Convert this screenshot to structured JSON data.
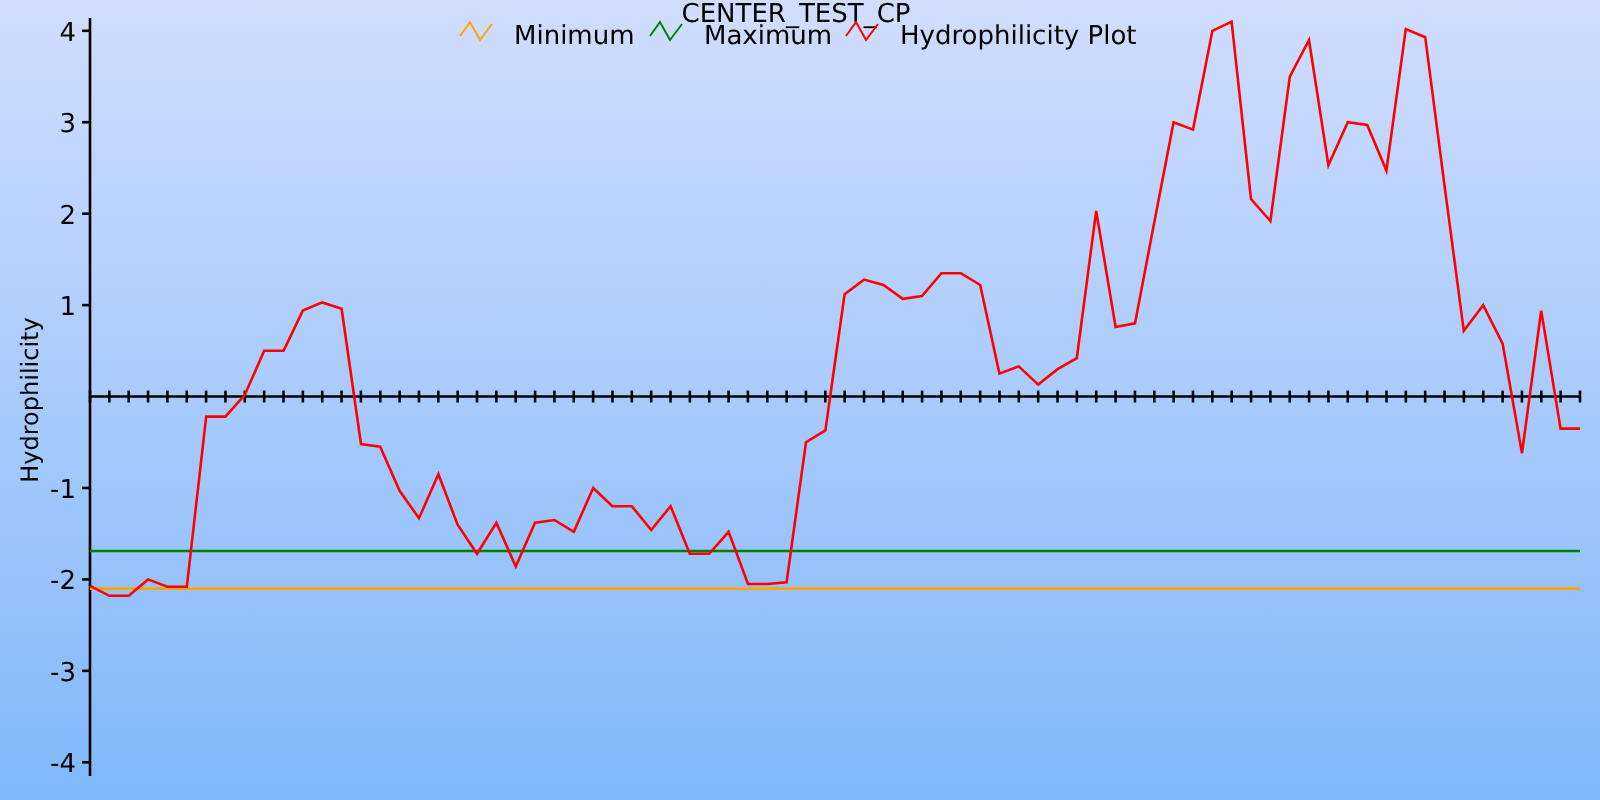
{
  "chart_data": {
    "type": "line",
    "title": "CENTER_TEST_CP",
    "ylabel": "Hydrophilicity",
    "ylim": [
      -4.15,
      4.14
    ],
    "legend": true,
    "yticks": [
      -4,
      -3,
      -2,
      -1,
      1,
      2,
      3,
      4
    ],
    "series": [
      {
        "name": "Minimum",
        "color": "#ffa500",
        "values": [
          -2.1,
          -2.1,
          -2.1,
          -2.1,
          -2.1,
          -2.1,
          -2.1,
          -2.1,
          -2.1,
          -2.1,
          -2.1,
          -2.1,
          -2.1,
          -2.1,
          -2.1,
          -2.1,
          -2.1,
          -2.1,
          -2.1,
          -2.1,
          -2.1,
          -2.1,
          -2.1,
          -2.1,
          -2.1,
          -2.1,
          -2.1,
          -2.1,
          -2.1,
          -2.1,
          -2.1,
          -2.1,
          -2.1,
          -2.1,
          -2.1,
          -2.1,
          -2.1,
          -2.1,
          -2.1,
          -2.1,
          -2.1,
          -2.1,
          -2.1,
          -2.1,
          -2.1,
          -2.1,
          -2.1,
          -2.1,
          -2.1,
          -2.1,
          -2.1,
          -2.1,
          -2.1,
          -2.1,
          -2.1,
          -2.1,
          -2.1,
          -2.1,
          -2.1,
          -2.1,
          -2.1,
          -2.1,
          -2.1,
          -2.1,
          -2.1,
          -2.1,
          -2.1,
          -2.1,
          -2.1,
          -2.1,
          -2.1,
          -2.1,
          -2.1,
          -2.1,
          -2.1,
          -2.1,
          -2.1,
          -2.1
        ]
      },
      {
        "name": "Maximum",
        "color": "#008000",
        "values": [
          -1.69,
          -1.69,
          -1.69,
          -1.69,
          -1.69,
          -1.69,
          -1.69,
          -1.69,
          -1.69,
          -1.69,
          -1.69,
          -1.69,
          -1.69,
          -1.69,
          -1.69,
          -1.69,
          -1.69,
          -1.69,
          -1.69,
          -1.69,
          -1.69,
          -1.69,
          -1.69,
          -1.69,
          -1.69,
          -1.69,
          -1.69,
          -1.69,
          -1.69,
          -1.69,
          -1.69,
          -1.69,
          -1.69,
          -1.69,
          -1.69,
          -1.69,
          -1.69,
          -1.69,
          -1.69,
          -1.69,
          -1.69,
          -1.69,
          -1.69,
          -1.69,
          -1.69,
          -1.69,
          -1.69,
          -1.69,
          -1.69,
          -1.69,
          -1.69,
          -1.69,
          -1.69,
          -1.69,
          -1.69,
          -1.69,
          -1.69,
          -1.69,
          -1.69,
          -1.69,
          -1.69,
          -1.69,
          -1.69,
          -1.69,
          -1.69,
          -1.69,
          -1.69,
          -1.69,
          -1.69,
          -1.69,
          -1.69,
          -1.69,
          -1.69,
          -1.69,
          -1.69,
          -1.69,
          -1.69,
          -1.69
        ]
      },
      {
        "name": "Hydrophilicity Plot",
        "color": "#ff0000",
        "values": [
          -2.07,
          -2.18,
          -2.18,
          -2.0,
          -2.08,
          -2.08,
          -0.22,
          -0.22,
          0.02,
          0.5,
          0.5,
          0.94,
          1.03,
          0.96,
          -0.52,
          -0.55,
          -1.03,
          -1.33,
          -0.85,
          -1.4,
          -1.72,
          -1.38,
          -1.86,
          -1.38,
          -1.35,
          -1.48,
          -1.0,
          -1.2,
          -1.2,
          -1.46,
          -1.2,
          -1.72,
          -1.72,
          -1.48,
          -2.05,
          -2.05,
          -2.03,
          -0.5,
          -0.37,
          1.12,
          1.28,
          1.22,
          1.07,
          1.1,
          1.35,
          1.35,
          1.22,
          0.25,
          0.33,
          0.13,
          0.3,
          0.42,
          2.03,
          0.76,
          0.8,
          1.9,
          3.0,
          2.92,
          4.0,
          4.1,
          2.16,
          1.92,
          3.5,
          3.9,
          2.53,
          3.0,
          2.97,
          2.47,
          4.02,
          3.93,
          2.3,
          0.72,
          1.0,
          0.58,
          -0.62,
          0.94,
          -0.35,
          -0.35
        ]
      }
    ]
  }
}
